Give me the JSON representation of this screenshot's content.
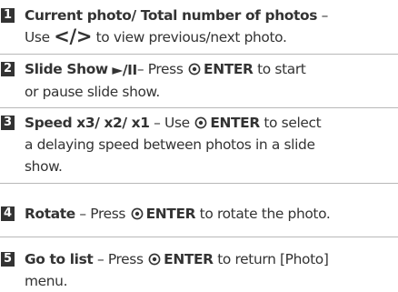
{
  "items": [
    {
      "number": "1",
      "title": "Current photo/ Total number of photos",
      "dash": " – ",
      "line2_pre": "Use ",
      "prev_glyph": "<",
      "slash": "/",
      "next_glyph": ">",
      "line2_post": " to view previous/next photo."
    },
    {
      "number": "2",
      "title": "Slide Show",
      "play_pause_glyph": "►/II",
      "dash": "– Press ",
      "enter_label": "ENTER",
      "line1_post": " to start",
      "line2": "or pause slide show."
    },
    {
      "number": "3",
      "title": "Speed x3/ x2/ x1",
      "dash": " – Use ",
      "enter_label": "ENTER",
      "line1_post": " to select",
      "line2": "a delaying speed between photos in a slide",
      "line3": "show."
    },
    {
      "number": "4",
      "title": "Rotate",
      "dash": " – Press ",
      "enter_label": "ENTER",
      "line1_post": " to rotate the photo."
    },
    {
      "number": "5",
      "title": "Go to list",
      "dash": " – Press ",
      "enter_label": "ENTER",
      "line1_post": " to return [Photo]",
      "line2": "menu."
    }
  ],
  "icons": {
    "enter": "enter-button-icon",
    "play_pause": "play-pause-icon",
    "prev_next": "prev-next-arrows-icon"
  },
  "colors": {
    "text": "#333333",
    "badge_bg": "#333333",
    "badge_text": "#ffffff",
    "separator": "#b8b8b8"
  }
}
